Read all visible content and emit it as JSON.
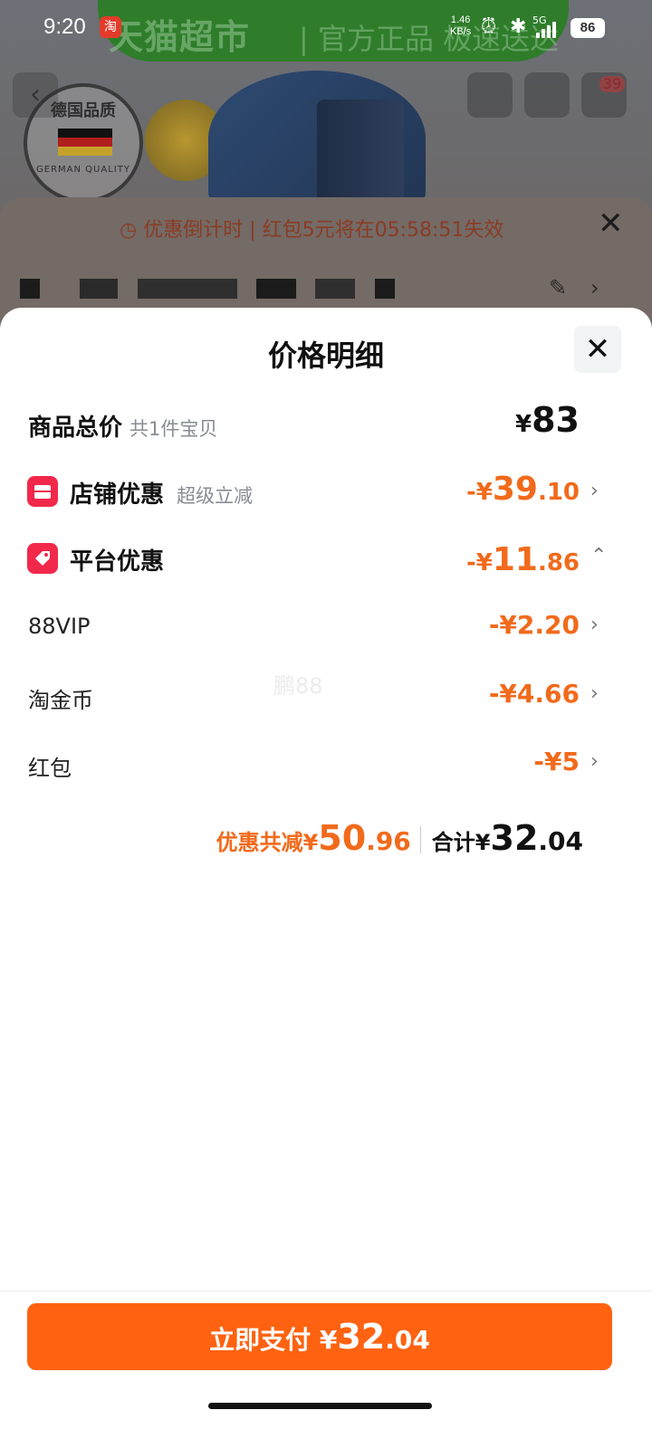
{
  "status_bar": {
    "time": "9:20",
    "app_icon_label": "淘",
    "net_speed_value": "1.46",
    "net_speed_unit": "KB/s",
    "network": "5G",
    "battery": "86",
    "icons": [
      "alarm-icon",
      "bluetooth-icon",
      "signal-icon",
      "battery-icon"
    ]
  },
  "background": {
    "banner_text": "天猫超市",
    "banner_sub": "| 官方正品 极速送达",
    "seal_top": "德国品质",
    "seal_bottom": "GERMAN QUALITY",
    "cart_badge": "39",
    "countdown_text": "优惠倒计时 | 红包5元将在05:58:51失效"
  },
  "sheet": {
    "title": "价格明细",
    "items": {
      "goods_total": {
        "label": "商品总价",
        "sub": "共1件宝贝",
        "symbol": "¥",
        "amount": "83"
      },
      "store_discount": {
        "label": "店铺优惠",
        "sub": "超级立减",
        "prefix": "-¥",
        "int": "39",
        "dec": ".10"
      },
      "platform_discount": {
        "label": "平台优惠",
        "prefix": "-¥",
        "int": "11",
        "dec": ".86"
      },
      "vip": {
        "label": "88VIP",
        "amount": "-¥2.20"
      },
      "coins": {
        "label": "淘金币",
        "amount": "-¥4.66"
      },
      "redpacket": {
        "label": "红包",
        "amount": "-¥5"
      }
    },
    "watermark": "鹏88",
    "summary": {
      "discount_label": "优惠共减¥",
      "discount_int": "50",
      "discount_dec": ".96",
      "total_label": "合计¥",
      "total_int": "32",
      "total_dec": ".04"
    }
  },
  "footer": {
    "pay_label": "立即支付 ¥",
    "pay_int": "32",
    "pay_dec": ".04"
  },
  "colors": {
    "accent_orange": "#ff6210",
    "discount_orange": "#f26a1b",
    "icon_red": "#f2284b"
  }
}
